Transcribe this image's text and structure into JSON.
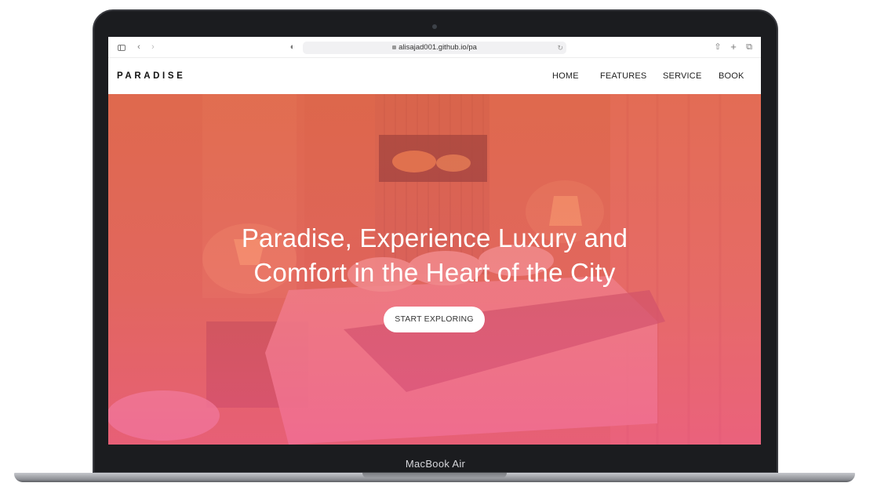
{
  "browser": {
    "url": "alisajad001.github.io/pa"
  },
  "site": {
    "logo": "PARADISE",
    "nav": [
      {
        "label": "HOME"
      },
      {
        "label": "FEATURES"
      },
      {
        "label": "SERVICE"
      },
      {
        "label": "BOOK"
      }
    ]
  },
  "hero": {
    "title_line1": "Paradise, Experience Luxury and",
    "title_line2": "Comfort in the Heart of the City",
    "cta_label": "START EXPLORING"
  },
  "device": {
    "label": "MacBook Air"
  },
  "colors": {
    "hero_top": "#d9684a",
    "hero_bottom": "#ee5f92",
    "cta_background": "#ffffff"
  }
}
